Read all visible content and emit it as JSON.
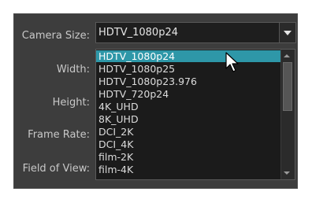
{
  "fields": {
    "camera_size_label": "Camera Size:",
    "width_label": "Width:",
    "height_label": "Height:",
    "frame_rate_label": "Frame Rate:",
    "field_of_view_label": "Field of View:"
  },
  "camera_size": {
    "selected": "HDTV_1080p24",
    "options": [
      "HDTV_1080p24",
      "HDTV_1080p25",
      "HDTV_1080p23.976",
      "HDTV_720p24",
      "4K_UHD",
      "8K_UHD",
      "DCI_2K",
      "DCI_4K",
      "film-2K",
      "film-4K"
    ],
    "highlighted_index": 0
  },
  "icons": {
    "dropdown_arrow": "chevron-down-icon",
    "mouse_cursor": "cursor-arrow-icon"
  },
  "colors": {
    "panel_bg": "#3d3d3d",
    "highlight": "#2e97a8"
  }
}
